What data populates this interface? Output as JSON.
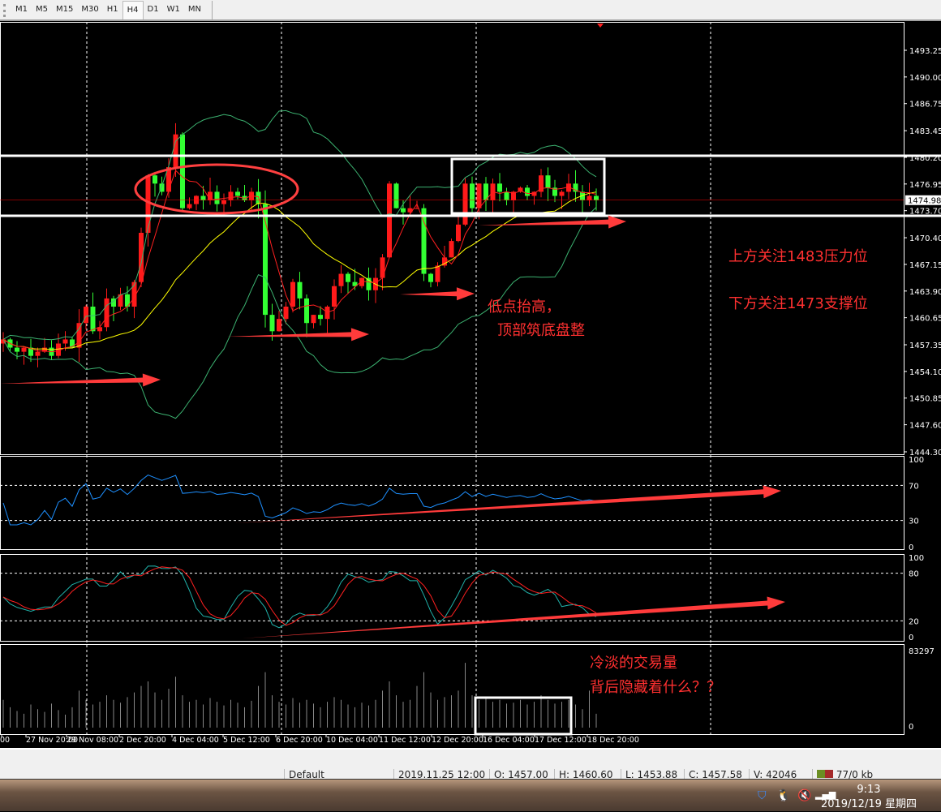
{
  "toolbar": {
    "timeframes": [
      "M1",
      "M5",
      "M15",
      "M30",
      "H1",
      "H4",
      "D1",
      "W1",
      "MN"
    ],
    "active": "H4"
  },
  "price_axis": [
    "1493.25",
    "1490.00",
    "1486.75",
    "1483.45",
    "1480.20",
    "1476.95",
    "1473.70",
    "1470.40",
    "1467.15",
    "1463.90",
    "1460.65",
    "1457.35",
    "1454.10",
    "1450.85",
    "1447.60",
    "1444.30"
  ],
  "current_price": "1474.98",
  "rsi_axis": [
    "100",
    "70",
    "30",
    "0"
  ],
  "stoch_axis": [
    "100",
    "80",
    "20",
    "0"
  ],
  "volume_axis": [
    "83297",
    "0"
  ],
  "time_axis": [
    "00",
    "27 Nov 20:00",
    "29 Nov 08:00",
    "2 Dec 20:00",
    "4 Dec 04:00",
    "5 Dec 12:00",
    "6 Dec 20:00",
    "10 Dec 04:00",
    "11 Dec 12:00",
    "12 Dec 20:00",
    "16 Dec 04:00",
    "17 Dec 12:00",
    "18 Dec 20:00"
  ],
  "annotations": {
    "resistance": "上方关注1483压力位",
    "support": "下方关注1473支撑位",
    "lows1": "低点抬高，",
    "lows2": "顶部筑底盘整",
    "vol1": "冷淡的交易量",
    "vol2": "背后隐藏着什么？？"
  },
  "colors": {
    "bull": "#ff1a1a",
    "bear": "#33ff33",
    "bands": "#3cb371",
    "ma_fast": "#ff2020",
    "ma_slow": "#ffff00",
    "rsi": "#1e90ff",
    "stoch_main": "#20b2aa",
    "stoch_signal": "#ff2020",
    "arrow": "#ff3b3b"
  },
  "chart_data": {
    "type": "candlestick",
    "symbol_timeframe": "H4",
    "closes": [
      1458,
      1457,
      1456.5,
      1457,
      1456,
      1456.5,
      1457,
      1456,
      1457.5,
      1458,
      1457,
      1460,
      1462,
      1459,
      1459.5,
      1463,
      1462,
      1463.5,
      1462,
      1465,
      1471,
      1478,
      1477,
      1476,
      1479,
      1483,
      1474,
      1474.5,
      1475.5,
      1475,
      1476,
      1474.5,
      1475,
      1476,
      1475.5,
      1475,
      1476,
      1474.5,
      1461,
      1459,
      1460.5,
      1462,
      1465,
      1463,
      1460,
      1461,
      1460.5,
      1462,
      1464.5,
      1466,
      1465,
      1464.5,
      1465.5,
      1464,
      1465.5,
      1468,
      1477,
      1474,
      1473.5,
      1474,
      1474,
      1466,
      1465,
      1467,
      1468,
      1470,
      1472,
      1477,
      1474,
      1477,
      1475,
      1477,
      1476,
      1475,
      1476,
      1476.5,
      1475.5,
      1476,
      1478,
      1476.5,
      1475.5,
      1476,
      1477,
      1476,
      1475,
      1475.5,
      1474.98
    ],
    "volumes": [
      30000,
      22000,
      18000,
      15000,
      25000,
      20000,
      17000,
      26000,
      19000,
      14000,
      22000,
      40000,
      30000,
      25000,
      28000,
      35000,
      30000,
      27000,
      33000,
      38000,
      45000,
      50000,
      38000,
      30000,
      42000,
      55000,
      35000,
      28000,
      30000,
      25000,
      32000,
      28000,
      24000,
      30000,
      27000,
      22000,
      29000,
      45000,
      60000,
      35000,
      28000,
      25000,
      32000,
      27000,
      30000,
      26000,
      22000,
      28000,
      33000,
      30000,
      25000,
      22000,
      27000,
      24000,
      30000,
      40000,
      50000,
      35000,
      28000,
      30000,
      45000,
      60000,
      38000,
      30000,
      33000,
      35000,
      40000,
      70000,
      35000,
      30000,
      32000,
      28000,
      30000,
      26000,
      27000,
      30000,
      25000,
      28000,
      35000,
      30000,
      26000,
      28000,
      30000,
      25000,
      20000,
      40000,
      15000
    ]
  },
  "status": {
    "profile": "Default",
    "time": "2019.11.25 12:00",
    "open": "O: 1457.00",
    "high": "H: 1460.60",
    "low": "L: 1453.88",
    "close": "C: 1457.58",
    "volume": "V: 42046",
    "traffic": "77/0 kb"
  },
  "taskbar": {
    "time": "9:13",
    "date": "2019/12/19 星期四"
  }
}
